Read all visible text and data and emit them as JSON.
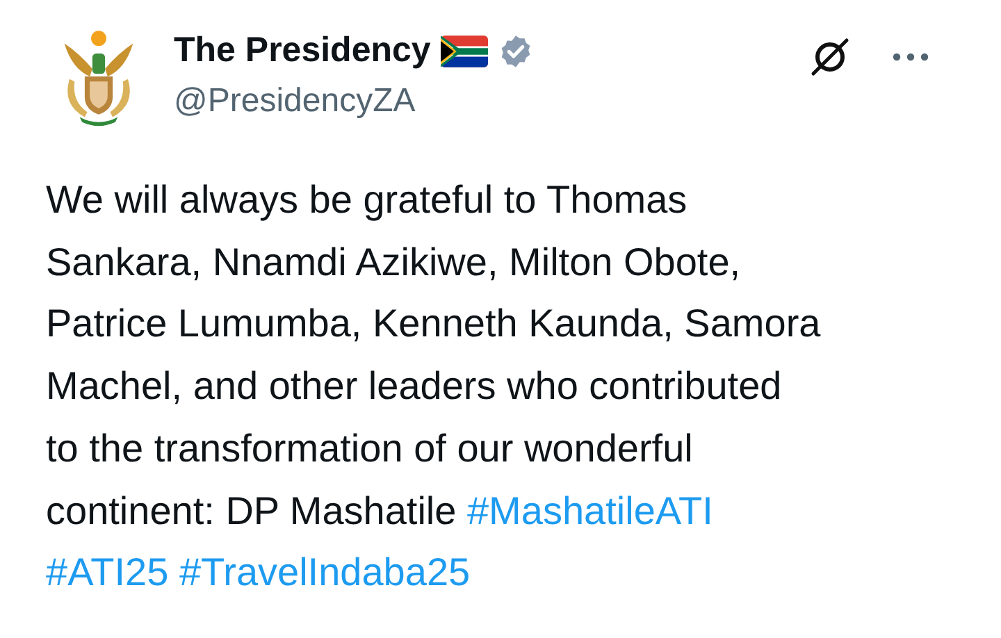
{
  "author": {
    "name": "The Presidency",
    "handle": "@PresidencyZA",
    "verified": true
  },
  "body": {
    "lines": [
      [
        {
          "kind": "text",
          "text": "We will always be grateful to Thomas"
        }
      ],
      [
        {
          "kind": "text",
          "text": "Sankara, Nnamdi Azikiwe, Milton Obote,"
        }
      ],
      [
        {
          "kind": "text",
          "text": "Patrice Lumumba, Kenneth Kaunda, Samora"
        }
      ],
      [
        {
          "kind": "text",
          "text": "Machel, and other leaders who contributed"
        }
      ],
      [
        {
          "kind": "text",
          "text": "to the transformation of our wonderful"
        }
      ],
      [
        {
          "kind": "text",
          "text": "continent: DP Mashatile "
        },
        {
          "kind": "hashtag",
          "text": "#MashatileATI"
        }
      ],
      [
        {
          "kind": "hashtag",
          "text": "#ATI25"
        },
        {
          "kind": "hashtag",
          "text": "#TravelIndaba25"
        }
      ]
    ]
  }
}
